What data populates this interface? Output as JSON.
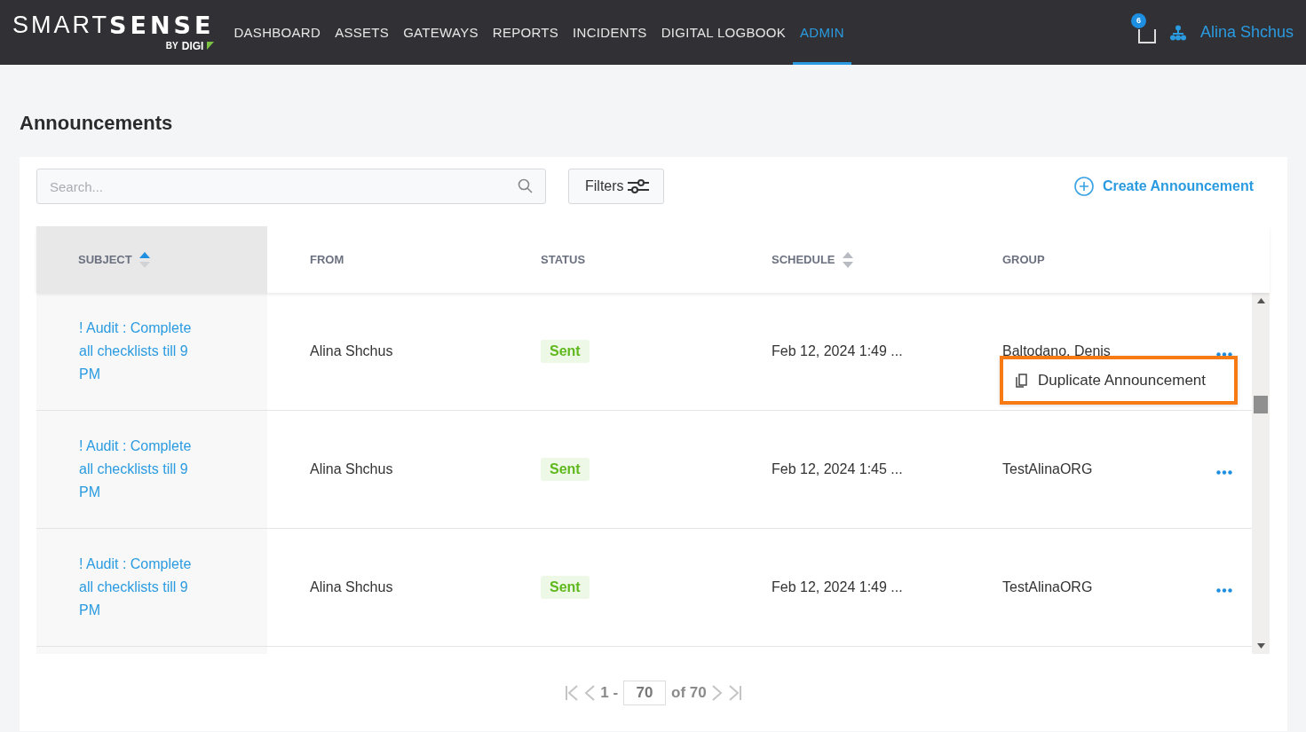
{
  "header": {
    "logo": {
      "light": "SMART",
      "bold": "SENSE",
      "by": "BY",
      "brand": "DIGI"
    },
    "nav": [
      {
        "label": "DASHBOARD",
        "selected": false
      },
      {
        "label": "ASSETS",
        "selected": false
      },
      {
        "label": "GATEWAYS",
        "selected": false
      },
      {
        "label": "REPORTS",
        "selected": false
      },
      {
        "label": "INCIDENTS",
        "selected": false
      },
      {
        "label": "DIGITAL LOGBOOK",
        "selected": false
      },
      {
        "label": "ADMIN",
        "selected": true
      }
    ],
    "inbox_count": "6",
    "user": "Alina Shchus"
  },
  "page_title": "Announcements",
  "toolbar": {
    "search": {
      "placeholder": "Search..."
    },
    "filters": "Filters",
    "create": "Create Announcement"
  },
  "table": {
    "columns": [
      {
        "label": "SUBJECT",
        "sort_icon": {
          "selected": true
        }
      },
      {
        "label": "FROM"
      },
      {
        "label": "STATUS"
      },
      {
        "label": "SCHEDULE",
        "sort_icon": {
          "selected": false
        }
      },
      {
        "label": "GROUP"
      }
    ],
    "rows": [
      {
        "subject": "! Audit : Complete all checklists till 9 PM",
        "from": "Alina Shchus",
        "status": "Sent",
        "schedule": "Feb 12, 2024 1:49 ...",
        "group": "Baltodano, Denis",
        "menu": [
          "Duplicate Announcement"
        ]
      },
      {
        "subject": "! Audit : Complete all checklists till 9 PM",
        "from": "Alina Shchus",
        "status": "Sent",
        "schedule": "Feb 12, 2024 1:45 ...",
        "group": "TestAlinaORG",
        "menu": []
      },
      {
        "subject": "! Audit : Complete all checklists till 9 PM",
        "from": "Alina Shchus",
        "status": "Sent",
        "schedule": "Feb 12, 2024 1:49 ...",
        "group": "TestAlinaORG",
        "menu": []
      }
    ]
  },
  "pagination": {
    "range_start": "1 -",
    "page_value": "70",
    "total": "of 70"
  }
}
